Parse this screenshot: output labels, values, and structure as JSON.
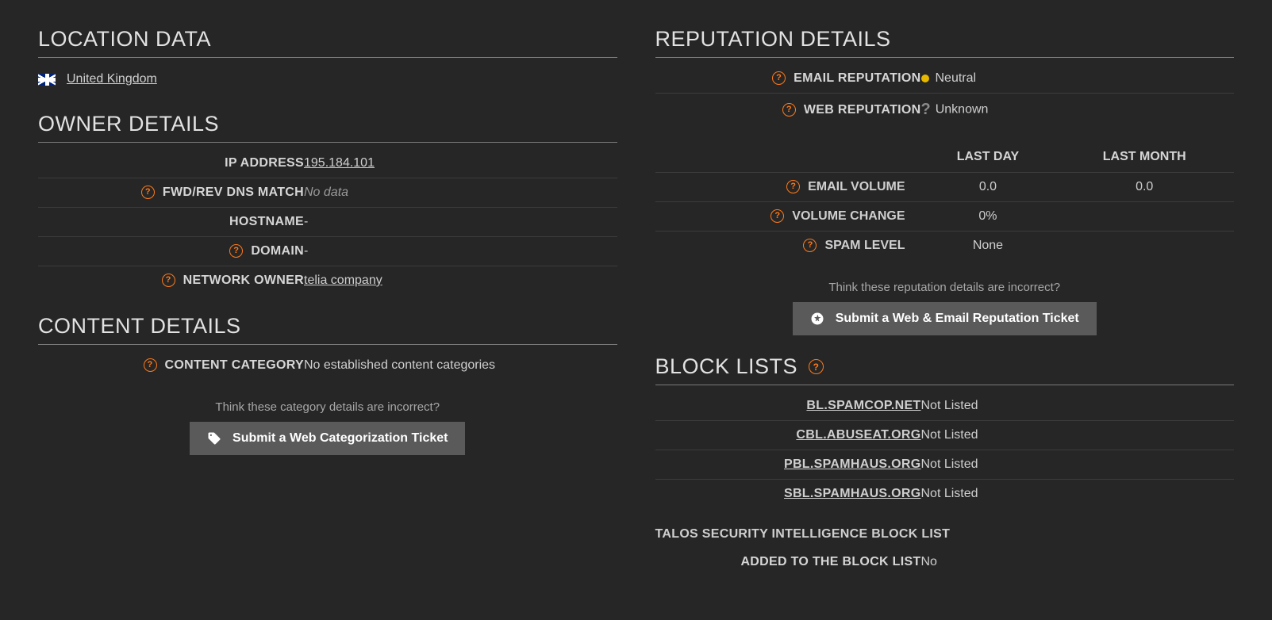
{
  "location": {
    "heading": "LOCATION DATA",
    "country": "United Kingdom"
  },
  "owner": {
    "heading": "OWNER DETAILS",
    "rows": {
      "ip_label": "IP ADDRESS",
      "ip_value": "195.184.101",
      "dns_label": "FWD/REV DNS MATCH",
      "dns_value": "No data",
      "host_label": "HOSTNAME",
      "host_value": "-",
      "domain_label": "DOMAIN",
      "domain_value": "-",
      "netown_label": "NETWORK OWNER",
      "netown_value": "telia company"
    }
  },
  "content": {
    "heading": "CONTENT DETAILS",
    "category_label": "CONTENT CATEGORY",
    "category_value": "No established content categories",
    "hint": "Think these category details are incorrect?",
    "button": "Submit a Web Categorization Ticket"
  },
  "reputation": {
    "heading": "REPUTATION DETAILS",
    "email_label": "EMAIL REPUTATION",
    "email_value": "Neutral",
    "web_label": "WEB REPUTATION",
    "web_value": "Unknown",
    "col_last_day": "LAST DAY",
    "col_last_month": "LAST MONTH",
    "emailvol_label": "EMAIL VOLUME",
    "emailvol_day": "0.0",
    "emailvol_month": "0.0",
    "volchange_label": "VOLUME CHANGE",
    "volchange_value": "0%",
    "spam_label": "SPAM LEVEL",
    "spam_value": "None",
    "hint": "Think these reputation details are incorrect?",
    "button": "Submit a Web & Email Reputation Ticket"
  },
  "blocklists": {
    "heading": "BLOCK LISTS",
    "rows": [
      {
        "name": "BL.SPAMCOP.NET",
        "status": "Not Listed"
      },
      {
        "name": "CBL.ABUSEAT.ORG",
        "status": "Not Listed"
      },
      {
        "name": "PBL.SPAMHAUS.ORG",
        "status": "Not Listed"
      },
      {
        "name": "SBL.SPAMHAUS.ORG",
        "status": "Not Listed"
      }
    ],
    "talos_heading": "TALOS SECURITY INTELLIGENCE BLOCK LIST",
    "added_label": "ADDED TO THE BLOCK LIST",
    "added_value": "No"
  }
}
